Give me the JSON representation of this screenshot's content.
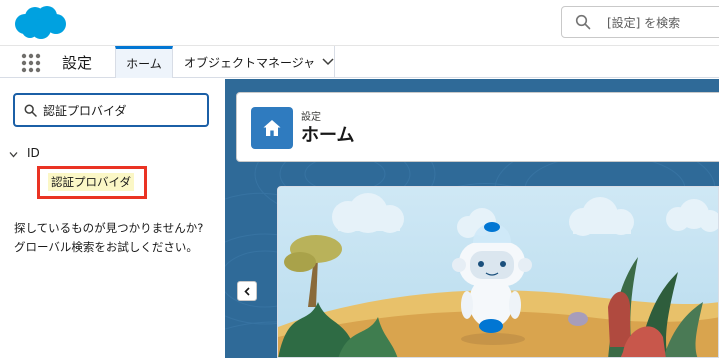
{
  "header": {
    "logo_name": "salesforce-cloud-logo",
    "search_placeholder": "[設定] を検索",
    "search_icon": "search-icon"
  },
  "nav": {
    "app_launcher_icon": "app-launcher-grid-icon",
    "app_name": "設定",
    "tabs": [
      {
        "label": "ホーム",
        "active": true
      },
      {
        "label": "オブジェクトマネージャ",
        "active": false,
        "has_dropdown": true
      }
    ]
  },
  "sidebar": {
    "quickfind_value": "認証プロバイダ",
    "tree": {
      "group_label": "ID",
      "expanded": true,
      "items": [
        {
          "label": "認証プロバイダ",
          "highlighted": true
        }
      ]
    },
    "no_result_line1": "探しているものが見つかりませんか?",
    "no_result_line2": "グローバル検索をお試しください。"
  },
  "main": {
    "page_eyebrow": "設定",
    "page_title": "ホーム",
    "header_icon": "home-icon",
    "collapse_icon": "chevron-left-icon"
  },
  "colors": {
    "brand_blue": "#00a1e0",
    "active_tab_border": "#0176d3",
    "highlight_box": "#ea3323",
    "search_highlight": "#fbf7c6",
    "background_blue": "#2f6a98",
    "home_tile": "#2f7bbf"
  }
}
